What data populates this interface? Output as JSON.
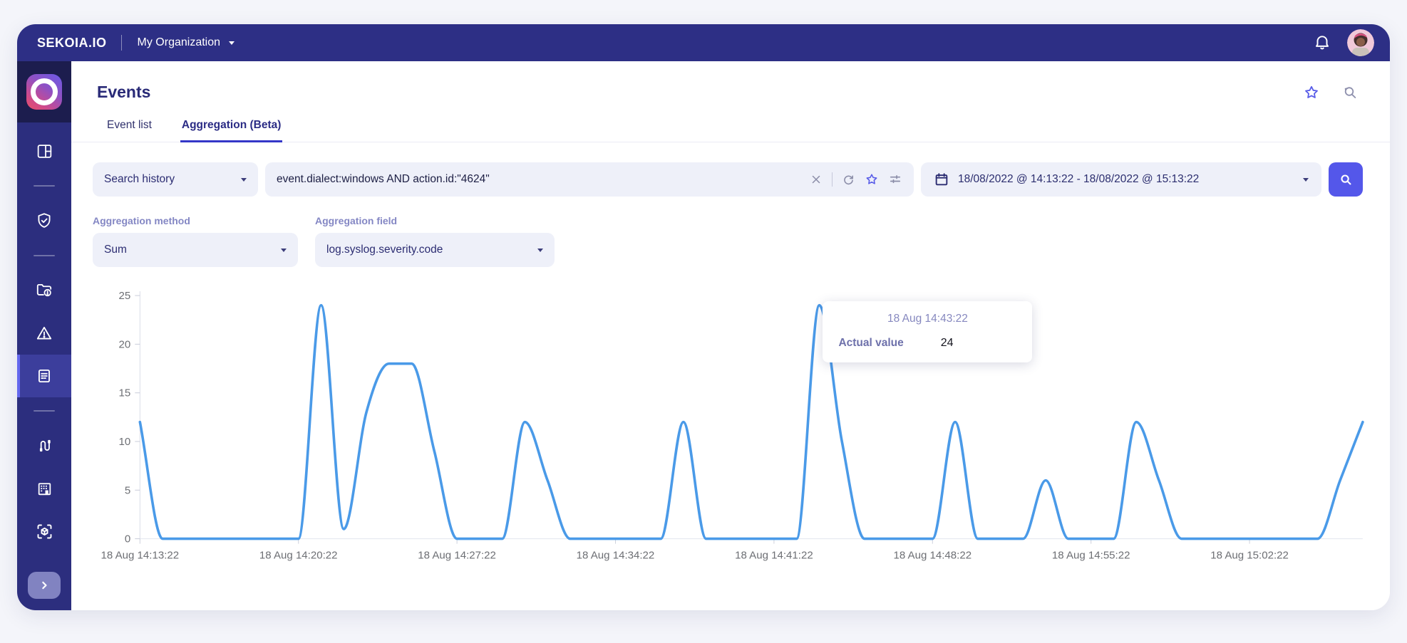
{
  "topbar": {
    "brand": "SEKOIA.IO",
    "org_label": "My Organization",
    "icons": [
      "bell-icon",
      "user-avatar"
    ]
  },
  "sidebar": {
    "items": [
      {
        "icon": "app-logo"
      },
      {
        "icon": "dashboard-icon"
      },
      {
        "icon": "shield-check-icon"
      },
      {
        "icon": "folder-alert-icon"
      },
      {
        "icon": "alert-triangle-icon"
      },
      {
        "icon": "events-log-icon",
        "active": true
      },
      {
        "icon": "connector-cable-icon"
      },
      {
        "icon": "building-icon"
      },
      {
        "icon": "cube-scan-icon"
      },
      {
        "icon": "expand-chevron-icon"
      }
    ]
  },
  "header": {
    "title": "Events",
    "actions": [
      "star-icon",
      "search-history-icon"
    ]
  },
  "tabs": [
    {
      "label": "Event list",
      "active": false
    },
    {
      "label": "Aggregation (Beta)",
      "active": true
    }
  ],
  "toolbar": {
    "search_history_label": "Search history",
    "query": "event.dialect:windows AND action.id:\"4624\"",
    "query_icons": [
      "clear-x-icon",
      "refresh-icon",
      "star-icon",
      "filters-sliders-icon"
    ],
    "date_range": "18/08/2022 @ 14:13:22 - 18/08/2022 @ 15:13:22"
  },
  "aggregation": {
    "method_label": "Aggregation method",
    "method_value": "Sum",
    "field_label": "Aggregation field",
    "field_value": "log.syslog.severity.code"
  },
  "tooltip": {
    "time": "18 Aug 14:43:22",
    "label": "Actual value",
    "value": "24"
  },
  "chart_data": {
    "type": "line",
    "title": "",
    "xlabel": "",
    "ylabel": "",
    "series_name": "Actual value",
    "x_unit": "minutes after 18 Aug 14:13:22",
    "x": [
      0,
      1,
      2,
      3,
      4,
      5,
      6,
      7,
      8,
      9,
      10,
      11,
      12,
      13,
      14,
      15,
      16,
      17,
      18,
      19,
      20,
      21,
      22,
      23,
      24,
      25,
      26,
      27,
      28,
      29,
      30,
      31,
      32,
      33,
      34,
      35,
      36,
      37,
      38,
      39,
      40,
      41,
      42,
      43,
      44,
      45,
      46,
      47,
      48,
      49,
      50,
      51,
      52,
      53,
      54
    ],
    "values": [
      12,
      0,
      0,
      0,
      0,
      0,
      0,
      0,
      24,
      1,
      13,
      18,
      18,
      9,
      0,
      0,
      0,
      12,
      6,
      0,
      0,
      0,
      0,
      0,
      12,
      0,
      0,
      0,
      0,
      0,
      24,
      10,
      0,
      0,
      0,
      0,
      12,
      0,
      0,
      0,
      6,
      0,
      0,
      0,
      12,
      6,
      0,
      0,
      0,
      0,
      0,
      0,
      0,
      6,
      12
    ],
    "ylim": [
      0,
      25
    ],
    "y_ticks": [
      0,
      5,
      10,
      15,
      20,
      25
    ],
    "x_tick_minutes": [
      0,
      7,
      14,
      21,
      28,
      35,
      42,
      49
    ],
    "x_tick_labels": [
      "18 Aug 14:13:22",
      "18 Aug 14:20:22",
      "18 Aug 14:27:22",
      "18 Aug 14:34:22",
      "18 Aug 14:41:22",
      "18 Aug 14:48:22",
      "18 Aug 14:55:22",
      "18 Aug 15:02:22"
    ],
    "highlighted_point": {
      "minute": 30,
      "value": 24,
      "time": "18 Aug 14:43:22"
    },
    "line_color": "#4a9ae8",
    "axis_text_color": "#6d6f74",
    "grid": false,
    "legend": false
  },
  "colors": {
    "topbar_bg": "#2d2f85",
    "sidebar_bg": "#2c2e7e",
    "accent_indigo": "#3437c8",
    "button_indigo": "#5457ea",
    "field_bg": "#eef0f9",
    "line_blue": "#4a9ae8"
  }
}
